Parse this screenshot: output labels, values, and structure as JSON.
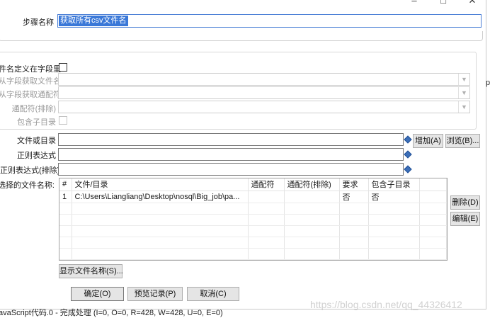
{
  "window": {
    "minimize_glyph": "–",
    "maximize_glyph": "□",
    "close_glyph": "✕"
  },
  "step_name": {
    "label": "步骤名称",
    "value": "获取所有csv文件名"
  },
  "field_group": {
    "filename_defined_in_field_label": "件名定义在字段里?",
    "get_filename_from_field_label": "从字段获取文件名",
    "get_wildcard_from_field_label": "从字段获取通配符",
    "wildcard_exclude_label": "通配符(排除)",
    "include_subfolders_label": "包含子目录"
  },
  "file_or_dir": {
    "label": "文件或目录",
    "value": ""
  },
  "regex": {
    "label": "正则表达式",
    "value": ""
  },
  "regex_exclude": {
    "label": "正则表达式(排除)",
    "value": ""
  },
  "selected_files": {
    "label": "选择的文件名称:"
  },
  "table": {
    "columns": [
      "#",
      "文件/目录",
      "通配符",
      "通配符(排除)",
      "要求",
      "包含子目录"
    ],
    "rows": [
      [
        "1",
        "C:\\Users\\Liangliang\\Desktop\\nosql\\Big_job\\pa...",
        "",
        "",
        "否",
        "否"
      ]
    ]
  },
  "buttons": {
    "add": "增加(A)",
    "browse": "浏览(B)...",
    "delete": "删除(D)",
    "edit": "编辑(E)",
    "show_filenames": "显示文件名称(S)...",
    "ok": "确定(O)",
    "preview": "预览记录(P)",
    "cancel": "取消(C)"
  },
  "right_edge_char": "p",
  "background_log": "avaScript代码.0 - 完成处理 (I=0, O=0, R=428, W=428, U=0, E=0)",
  "watermark": "https://blog.csdn.net/qq_44326412"
}
